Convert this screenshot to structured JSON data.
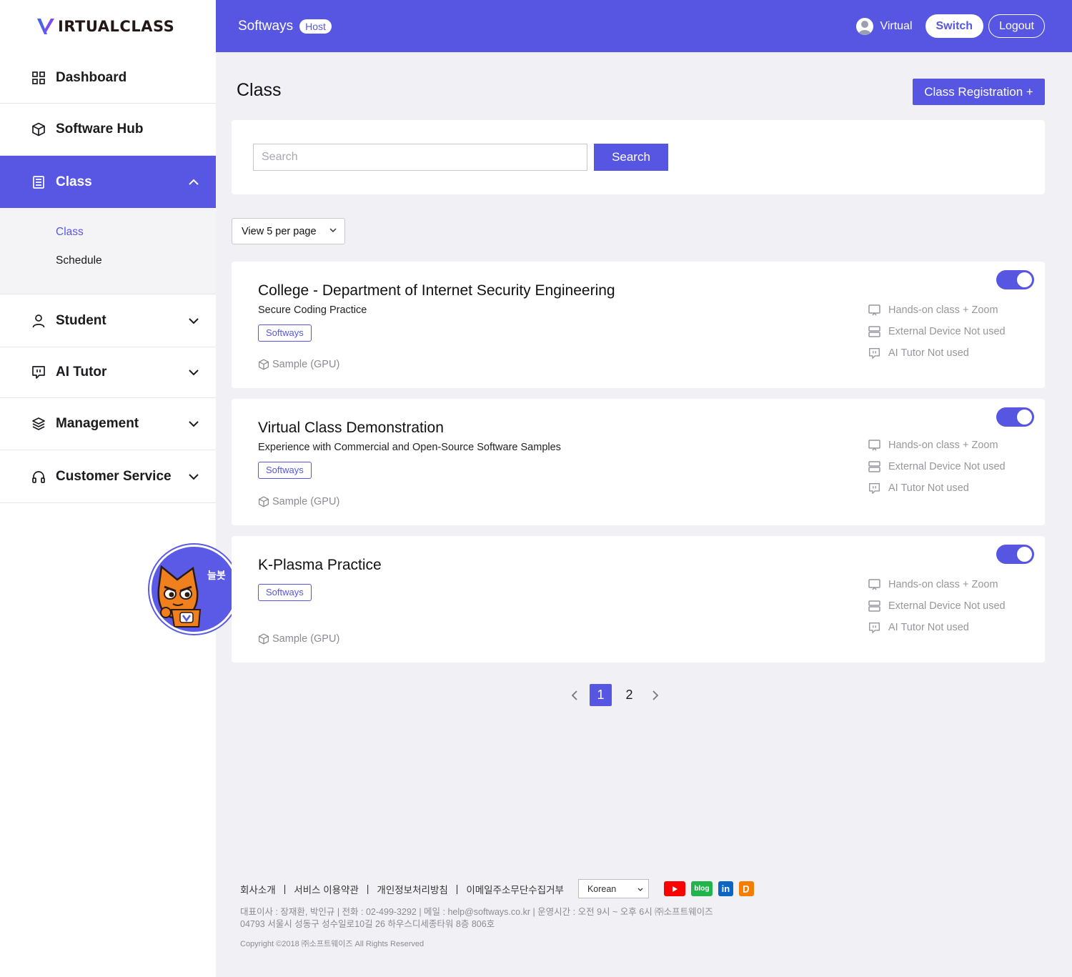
{
  "brand": {
    "logo_text_a": "IRTUAL",
    "logo_text_b": "CLASS"
  },
  "sidebar": {
    "items": [
      {
        "label": "Dashboard",
        "icon": "grid-icon"
      },
      {
        "label": "Software Hub",
        "icon": "cube-icon"
      },
      {
        "label": "Class",
        "icon": "document-icon",
        "expanded": true
      },
      {
        "label": "Student",
        "icon": "user-icon"
      },
      {
        "label": "AI Tutor",
        "icon": "chat-bubble-icon"
      },
      {
        "label": "Management",
        "icon": "layers-icon"
      },
      {
        "label": "Customer Service",
        "icon": "headset-icon"
      }
    ],
    "class_sub": [
      "Class",
      "Schedule"
    ],
    "mascot_badge": "늘봇"
  },
  "header": {
    "org": "Softways",
    "role_badge": "Host",
    "user_name": "Virtual",
    "switch_label": "Switch",
    "logout_label": "Logout"
  },
  "page": {
    "title": "Class",
    "register_label": "Class Registration  +",
    "search_placeholder": "Search",
    "search_value": "",
    "search_button": "Search",
    "per_page_label": "View 5 per page"
  },
  "classes": [
    {
      "title": "College - Department of Internet Security Engineering",
      "desc": "Secure Coding Practice",
      "tag": "Softways",
      "sample": "Sample (GPU)",
      "enabled": true,
      "features": [
        "Hands-on class + Zoom",
        "External Device Not used",
        "AI Tutor Not used"
      ]
    },
    {
      "title": "Virtual Class Demonstration",
      "desc": "Experience with Commercial and Open-Source Software Samples",
      "tag": "Softways",
      "sample": "Sample (GPU)",
      "enabled": true,
      "features": [
        "Hands-on class + Zoom",
        "External Device Not used",
        "AI Tutor Not used"
      ]
    },
    {
      "title": "K-Plasma Practice",
      "desc": "",
      "tag": "Softways",
      "sample": "Sample (GPU)",
      "enabled": true,
      "features": [
        "Hands-on class + Zoom",
        "External Device Not used",
        "AI Tutor Not used"
      ]
    }
  ],
  "pagination": {
    "pages": [
      "1",
      "2"
    ],
    "current": "1"
  },
  "footer": {
    "links": [
      "회사소개",
      "서비스 이용약관",
      "개인정보처리방침",
      "이메일주소무단수집거부"
    ],
    "language": "Korean",
    "social": [
      {
        "name": "youtube-icon",
        "color": "#ff0000",
        "text": ""
      },
      {
        "name": "blog-icon",
        "color": "#21b44b",
        "text": "blog"
      },
      {
        "name": "linkedin-icon",
        "color": "#0a66c2",
        "text": "in"
      },
      {
        "name": "blogger-icon",
        "color": "#f57d00",
        "text": ""
      }
    ],
    "info_line1": "대표이사 : 장재환, 박인규 | 전화 : 02-499-3292 | 메일 : help@softways.co.kr | 운영시간 : 오전 9시 ~ 오후 6시 ㈜소프트웨이즈",
    "info_line2": "04793 서울시 성동구 성수일로10길 26 하우스디세종타워 8층 806호",
    "copyright": "Copyright ©2018 ㈜소프트웨이즈 All Rights Reserved"
  },
  "colors": {
    "accent": "#5656e3",
    "mascot": "#f07f1e"
  }
}
